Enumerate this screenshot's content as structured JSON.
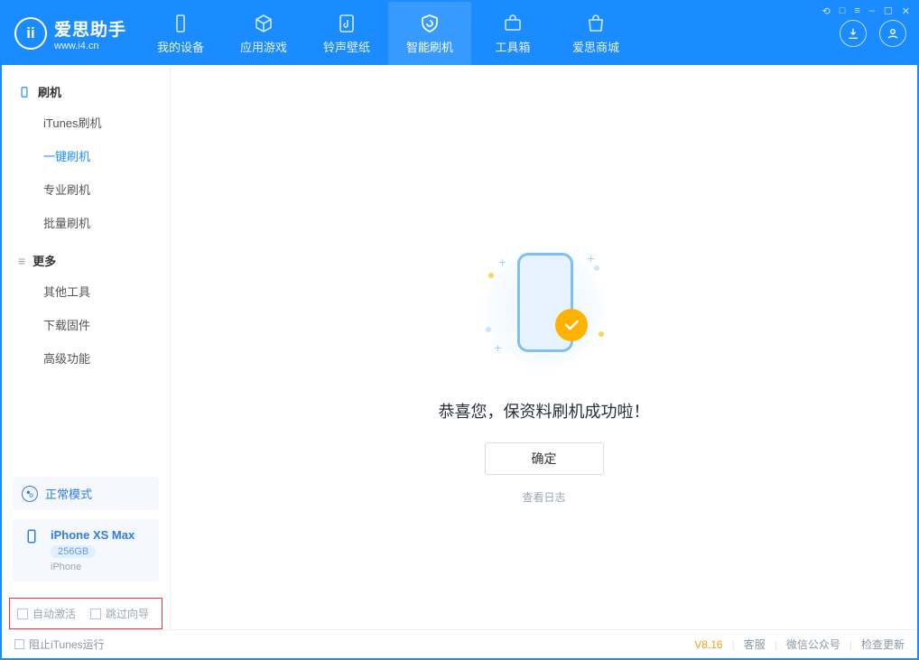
{
  "brand": {
    "title": "爱思助手",
    "sub": "www.i4.cn",
    "logo_text": "ii"
  },
  "tabs": [
    {
      "label": "我的设备"
    },
    {
      "label": "应用游戏"
    },
    {
      "label": "铃声壁纸"
    },
    {
      "label": "智能刷机"
    },
    {
      "label": "工具箱"
    },
    {
      "label": "爱思商城"
    }
  ],
  "win_controls": [
    "⟲",
    "□",
    "≡",
    "–",
    "☐",
    "✕"
  ],
  "sidebar": {
    "section_flash": "刷机",
    "items_flash": [
      "iTunes刷机",
      "一键刷机",
      "专业刷机",
      "批量刷机"
    ],
    "section_more": "更多",
    "items_more": [
      "其他工具",
      "下载固件",
      "高级功能"
    ]
  },
  "mode": {
    "label": "正常模式"
  },
  "device": {
    "name": "iPhone XS Max",
    "capacity": "256GB",
    "type": "iPhone"
  },
  "checkrow": {
    "auto_activate": "自动激活",
    "skip_guide": "跳过向导"
  },
  "content": {
    "success_text": "恭喜您，保资料刷机成功啦！",
    "ok_label": "确定",
    "log_link": "查看日志"
  },
  "footer": {
    "block_itunes": "阻止iTunes运行",
    "version": "V8.16",
    "links": [
      "客服",
      "微信公众号",
      "检查更新"
    ]
  }
}
